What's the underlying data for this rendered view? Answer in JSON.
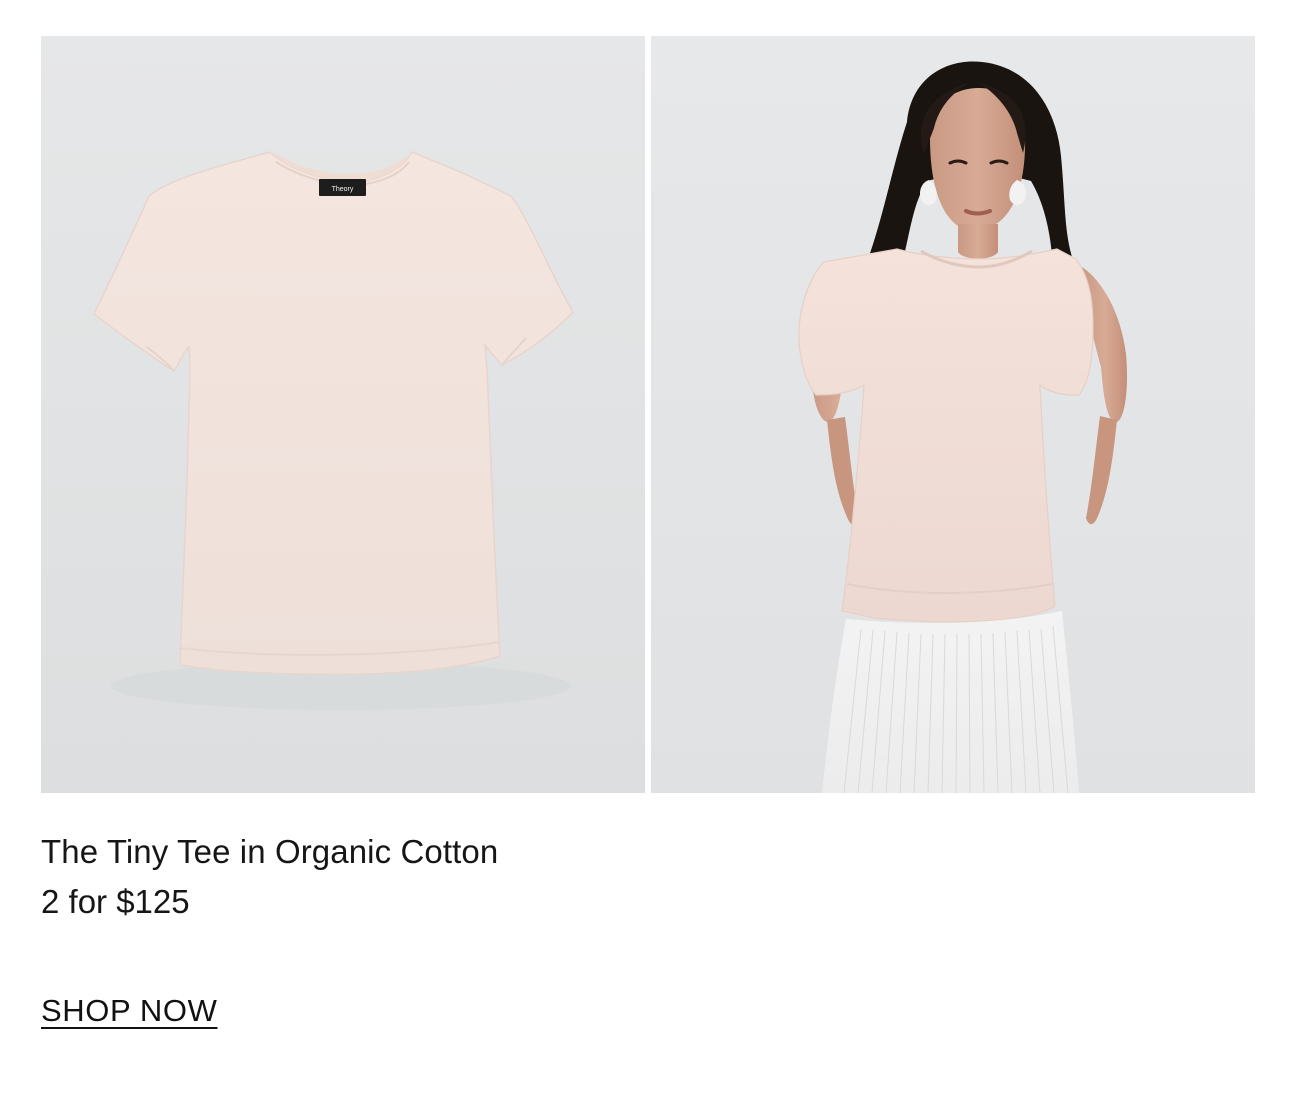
{
  "product": {
    "title": "The Tiny Tee in Organic Cotton",
    "price": "2 for $125",
    "brand_label": "Theory"
  },
  "cta": {
    "label": "SHOP NOW"
  },
  "colors": {
    "background": "#ffffff",
    "photo_bg": "#e3e5e6",
    "tee": "#f3e3dd",
    "skirt": "#eeeeee",
    "text": "#161616"
  },
  "images": [
    {
      "semantic": "product-flatlay-image"
    },
    {
      "semantic": "model-wearing-tee-image"
    }
  ]
}
